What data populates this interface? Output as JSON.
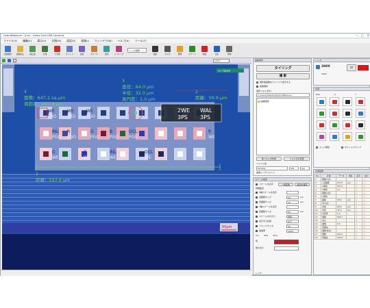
{
  "window": {
    "title": "HybridMeasure - [Live - Seiwa Cam USB Camera]",
    "controls": [
      "─",
      "□",
      "✕"
    ]
  },
  "menu": [
    "ファイル(F)",
    "編集(E)",
    "表示(V)",
    "計測(M)",
    "設定(S)",
    "画像(I)",
    "ウィンドウ(W)",
    "ヘルプ(H)",
    "ツール(T)"
  ],
  "toolbar": {
    "buttons": [
      {
        "label": "画像保存",
        "icon": "save-image-icon",
        "color": "#2b7bd8"
      },
      {
        "label": "画像読込",
        "icon": "open-image-icon",
        "color": "#e8b02a"
      },
      {
        "label": "静止画",
        "icon": "still-icon",
        "color": "#4aa04a"
      },
      {
        "label": "計測",
        "icon": "measure-icon",
        "color": "#3a7d3a"
      },
      {
        "label": "十字線",
        "icon": "crosshair-icon",
        "color": "#d82a2a"
      },
      {
        "label": "グリッド",
        "icon": "grid-icon",
        "color": "#5b7fd0"
      },
      {
        "label": "比較",
        "icon": "compare-icon",
        "color": "#7b5bd0"
      },
      {
        "label": "スケール",
        "icon": "scale-icon",
        "color": "#d07b2b"
      },
      {
        "label": "合成",
        "icon": "composite-icon",
        "color": "#2ba0a0"
      },
      {
        "label": "トリミング",
        "icon": "trim-icon",
        "color": "#c03a8a"
      }
    ],
    "select_value": "レンズ倍率",
    "buttons2": [
      {
        "label": "設定",
        "icon": "settings-icon",
        "color": "#333333"
      },
      {
        "label": "カメラ",
        "icon": "camera-icon",
        "color": "#555555"
      },
      {
        "label": "照明",
        "icon": "light-icon",
        "color": "#e0a020"
      },
      {
        "label": "ステージ",
        "icon": "stage-icon",
        "color": "#2a8a2a"
      },
      {
        "label": "録画",
        "icon": "record-icon",
        "color": "#d02020"
      },
      {
        "label": "出力",
        "icon": "export-icon",
        "color": "#2060c0"
      },
      {
        "label": "印刷",
        "icon": "print-icon",
        "color": "#666666"
      }
    ]
  },
  "image_view": {
    "zoom_combo": "100%",
    "badge": "ライブ表示中",
    "scale_bar": "50μm",
    "measurements": {
      "m1": {
        "index": "1",
        "text": "距離：537.5 μm"
      },
      "m2": {
        "index": "2",
        "text": "距離：59.9 μm"
      },
      "m3": {
        "index": "3",
        "lines": [
          "直径：64.0 μm",
          "半径：32.0 μm",
          "真円度：1.0 μm"
        ]
      },
      "m4": {
        "index": "4",
        "lines": [
          "面積：647.2 sq.μm",
          "周囲長：101.8 μm"
        ]
      }
    },
    "chip_labels": [
      "WE",
      "TRO",
      "WE",
      "TRO",
      "WE",
      "PGO",
      "INL",
      "PGO",
      "R",
      "PGO",
      "G",
      "PGO",
      "B",
      "PGO",
      "OCL",
      "PGO",
      "R",
      "WE",
      "G",
      "WE",
      "B",
      "WE",
      "INL",
      "WE",
      "OCL",
      "WE"
    ],
    "boxed_labels": [
      [
        "2WE",
        "3PS"
      ],
      [
        "WAL",
        "3PS"
      ]
    ]
  },
  "capture_panel": {
    "title": "画像保存",
    "tiling_label": "タイリング",
    "capture_label": "撮 影",
    "check_prefix": "撮影後画像をウインドウ表示する",
    "check_auto": "連番保存",
    "folder_label": "保存フォルダ(F)",
    "folder_path": "C:\\Users\\Desktop\\HybridMeasure",
    "tree_item": "画像保存",
    "new_folder": "新フォルダ作成",
    "change_folder": "フォルダの変更",
    "filename_label": "ファイル名",
    "filename_value": "Sample",
    "ext_value": "001",
    "ext_type": "jpg",
    "increment_label": "連番インクリメント"
  },
  "scale_panel": {
    "title": "スケール設定",
    "show_scale": "スケールを表示",
    "show_scale_btn1": "一括変更",
    "show_scale_btn2": "設定を保存",
    "detail": "詳細設定",
    "rows": [
      {
        "label": "X軸スケールを表示",
        "value": ""
      },
      {
        "label": "目盛線サイズ",
        "value": "50",
        "unit": "μm"
      },
      {
        "label": "目盛線サイズ",
        "value": "10",
        "unit": "μm"
      },
      {
        "label": "Y軸スケールを表示",
        "value": ""
      },
      {
        "label": "目盛線サイズ",
        "value": "50",
        "unit": "μm"
      },
      {
        "label": "スケールの大きさ",
        "value": "標準"
      },
      {
        "label": "表示する位置",
        "value": "右下"
      },
      {
        "label": "フォントサイズ",
        "value": "50"
      },
      {
        "label": "透過率",
        "value": "100%"
      }
    ],
    "radio_options": [
      "1%",
      "30%",
      "50%"
    ],
    "color_label": "色",
    "color_value": "#d81818",
    "thickness_label": "線の太さ",
    "footer": "レイヤ"
  },
  "lens_panel": {
    "title": "レンズ",
    "lens_value": "300X",
    "calib_value": "200X"
  },
  "draw_panel": {
    "title": "計測",
    "tabs": [
      "ESC",
      "X",
      "Y"
    ],
    "checkbox1": "エッジ検出",
    "checkbox2": "ポイントスナップ"
  },
  "results_panel": {
    "title": "計測結果",
    "headers": [
      "No.",
      "計測",
      "データ",
      "単位",
      "表示",
      "出力"
    ],
    "rows": [
      [
        "1",
        "距離(1点)",
        "",
        "",
        "○",
        "○"
      ],
      [
        "2",
        "1点面積",
        "537.5",
        "μm",
        "○",
        "○"
      ],
      [
        "3",
        "X座標",
        "537.5",
        "",
        "○",
        "○"
      ],
      [
        "4",
        "Y座標",
        "4.7",
        "",
        "○",
        "×"
      ],
      [
        "5",
        "距離(2点)",
        "",
        "",
        "○",
        "○"
      ],
      [
        "6",
        "X座標",
        "",
        "",
        "○",
        "○"
      ],
      [
        "7",
        "距離",
        "59.9",
        "μm",
        "○",
        "○"
      ],
      [
        "8",
        "円(3点)",
        "",
        "",
        "○",
        "○"
      ],
      [
        "9",
        "直径",
        "64.0",
        "μm",
        "○",
        "○"
      ],
      [
        "10",
        "半径",
        "32.0",
        "μm",
        "○",
        "○"
      ],
      [
        "11",
        "円周率",
        "1.0",
        "",
        "○",
        "○"
      ],
      [
        "12",
        "面積",
        "644.7",
        "",
        "○",
        "○"
      ],
      [
        "13",
        "中心",
        "",
        "",
        "○",
        "○"
      ],
      [
        "14",
        "面積",
        "0.0",
        "",
        "○",
        "○"
      ],
      [
        "15",
        "周囲長",
        "",
        "",
        "○",
        "○"
      ],
      [
        "16",
        "面積(多点)",
        "",
        "",
        "○",
        "○"
      ],
      [
        "17",
        "面積",
        "647.2",
        "",
        "○",
        "○"
      ],
      [
        "18",
        "周囲長",
        "101.8",
        "",
        "○",
        "○"
      ]
    ]
  },
  "colors": {
    "measure_green": "#6fd06f",
    "accent_red": "#e02020",
    "panel_header": "#d8dfe8",
    "image_blue": "#1e4fa8"
  }
}
